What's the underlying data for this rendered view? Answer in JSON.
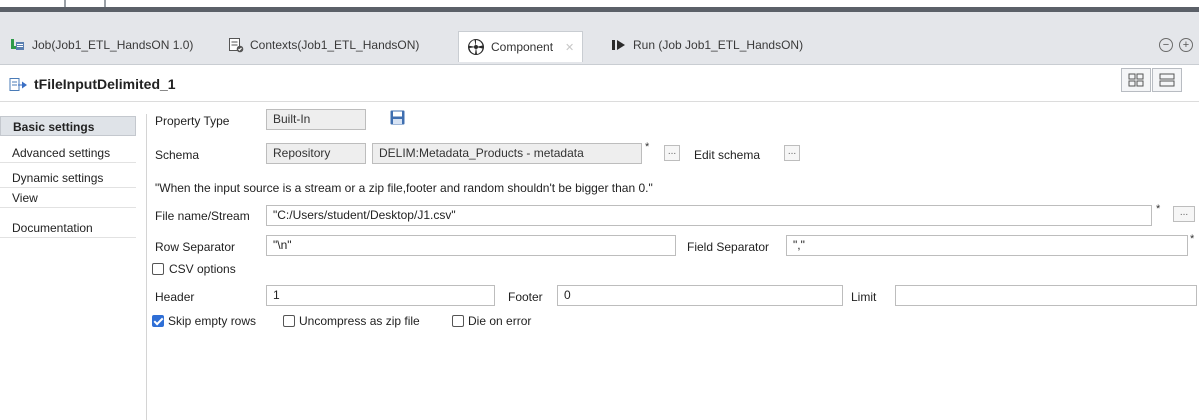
{
  "tabs": [
    {
      "label": "Job(Job1_ETL_HandsON 1.0)",
      "icon": "job-icon"
    },
    {
      "label": "Contexts(Job1_ETL_HandsON)",
      "icon": "contexts-icon"
    },
    {
      "label": "Component",
      "icon": "component-icon",
      "active": true
    },
    {
      "label": "Run (Job Job1_ETL_HandsON)",
      "icon": "run-icon"
    }
  ],
  "window_controls": {
    "minimize": "−",
    "maximize": "+"
  },
  "component": {
    "title": "tFileInputDelimited_1"
  },
  "sidebar": {
    "items": [
      {
        "label": "Basic settings",
        "active": true
      },
      {
        "label": "Advanced settings"
      },
      {
        "label": "Dynamic settings"
      },
      {
        "label": "View"
      },
      {
        "label": "Documentation"
      }
    ]
  },
  "form": {
    "property_type_label": "Property Type",
    "property_type_value": "Built-In",
    "schema_label": "Schema",
    "schema_type_value": "Repository",
    "schema_repo_value": "DELIM:Metadata_Products - metadata",
    "star": "*",
    "ellipsis": "...",
    "edit_schema_label": "Edit schema",
    "notice": "\"When the input source is a stream or a zip file,footer and random shouldn't be bigger than 0.\"",
    "file_name_label": "File name/Stream",
    "file_name_value": "\"C:/Users/student/Desktop/J1.csv\"",
    "row_separator_label": "Row Separator",
    "row_separator_value": "\"\\n\"",
    "field_separator_label": "Field Separator",
    "field_separator_value": "\",\"",
    "csv_options_label": "CSV options",
    "header_label": "Header",
    "header_value": "1",
    "footer_label": "Footer",
    "footer_value": "0",
    "limit_label": "Limit",
    "limit_value": "",
    "skip_empty_rows_label": "Skip empty rows",
    "skip_empty_rows_checked": true,
    "uncompress_label": "Uncompress as zip file",
    "uncompress_checked": false,
    "die_on_error_label": "Die on error",
    "die_on_error_checked": false
  },
  "colors": {
    "accent": "#2f6fd6",
    "tabbar": "#e4e6ea",
    "sidebar_active": "#dfe3e8"
  }
}
